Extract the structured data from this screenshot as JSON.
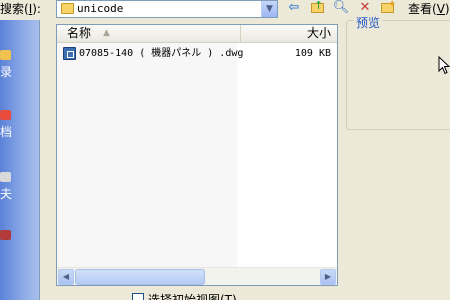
{
  "toolbar": {
    "lookin_label": "搜索",
    "lookin_hotkey": "I",
    "lookin_value": "unicode",
    "view_label": "查看",
    "view_hotkey": "V"
  },
  "places": [
    {
      "label": "录"
    },
    {
      "label": "档"
    },
    {
      "label": "夫"
    }
  ],
  "filelist": {
    "columns": {
      "name": "名称",
      "size": "大小"
    },
    "files": [
      {
        "name": "07085-140 ( 機器パネル ) .dwg",
        "size": "109 KB"
      }
    ]
  },
  "preview": {
    "label": "预览"
  },
  "options": {
    "initial_view_label": "选择初始视图(T)"
  },
  "colors": {
    "accent_blue": "#1f56c9",
    "places_bar": "#6f93dd",
    "window_bg": "#ece9d8"
  }
}
